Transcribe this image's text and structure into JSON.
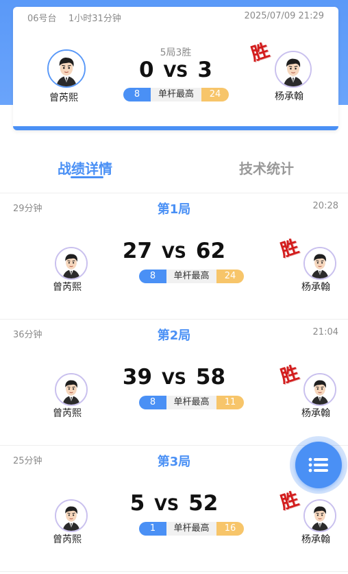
{
  "summary": {
    "table": "06号台",
    "duration": "1小时31分钟",
    "datetime": "2025/07/09 21:29",
    "format": "5局3胜",
    "left_player": {
      "name": "曾芮熙",
      "score": "0",
      "high_break": "8"
    },
    "right_player": {
      "name": "杨承翰",
      "score": "3",
      "high_break": "24"
    },
    "vs": "VS",
    "break_label": "单杆最高",
    "winner_stamp": "胜"
  },
  "tabs": [
    {
      "label": "战绩详情",
      "active": true
    },
    {
      "label": "技术统计",
      "active": false
    }
  ],
  "frames": [
    {
      "title": "第1局",
      "duration": "29分钟",
      "time": "20:28",
      "left_name": "曾芮熙",
      "right_name": "杨承翰",
      "left_score": "27",
      "right_score": "62",
      "left_break": "8",
      "right_break": "24",
      "vs": "VS",
      "break_label": "单杆最高",
      "stamp": "胜"
    },
    {
      "title": "第2局",
      "duration": "36分钟",
      "time": "21:04",
      "left_name": "曾芮熙",
      "right_name": "杨承翰",
      "left_score": "39",
      "right_score": "58",
      "left_break": "8",
      "right_break": "11",
      "vs": "VS",
      "break_label": "单杆最高",
      "stamp": "胜"
    },
    {
      "title": "第3局",
      "duration": "25分钟",
      "time": "",
      "left_name": "曾芮熙",
      "right_name": "杨承翰",
      "left_score": "5",
      "right_score": "52",
      "left_break": "1",
      "right_break": "16",
      "vs": "VS",
      "break_label": "单杆最高",
      "stamp": "胜"
    }
  ],
  "fab": {
    "icon": "list-icon"
  },
  "colors": {
    "accent": "#4a90f5",
    "gold": "#f7c56a",
    "win": "#d31b1b"
  }
}
